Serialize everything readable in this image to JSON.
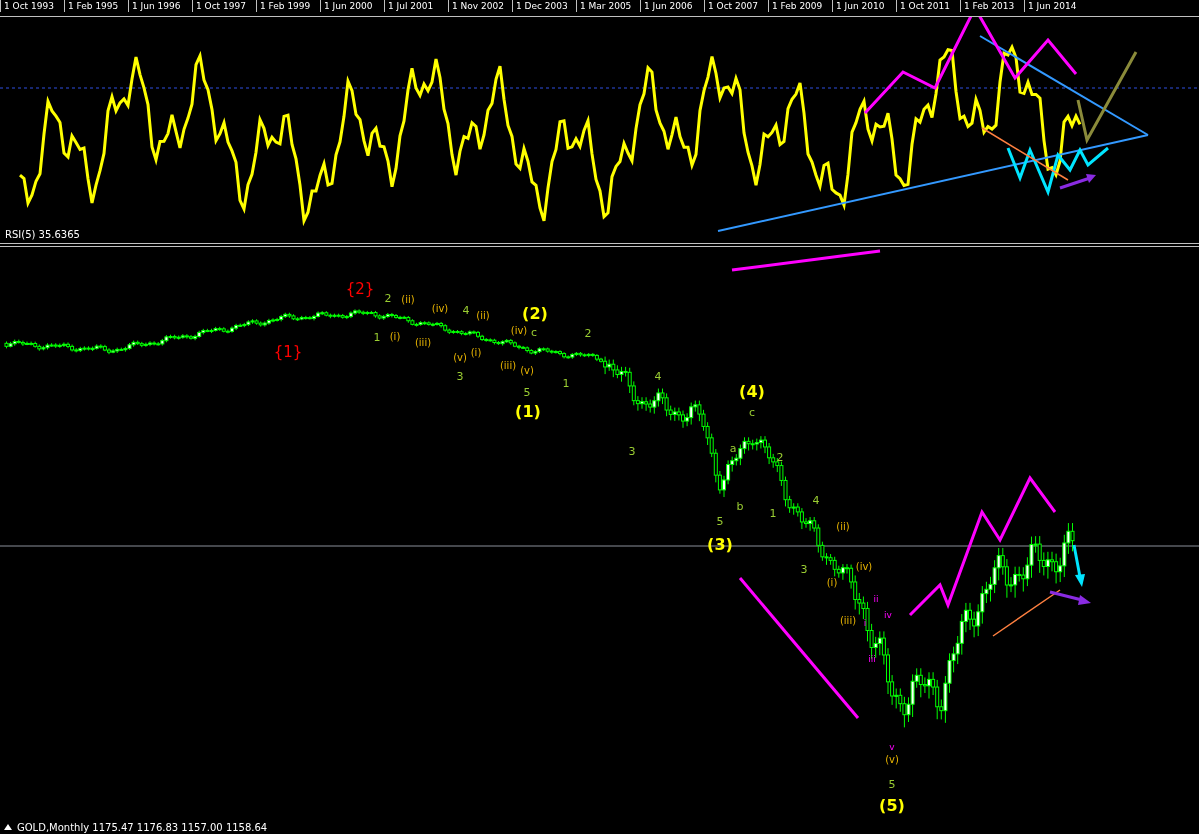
{
  "time_axis": {
    "labels": [
      "1 Oct 1993",
      "1 Feb 1995",
      "1 Jun 1996",
      "1 Oct 1997",
      "1 Feb 1999",
      "1 Jun 2000",
      "1 Jul 2001",
      "1 Nov 2002",
      "1 Dec 2003",
      "1 Mar 2005",
      "1 Jun 2006",
      "1 Oct 2007",
      "1 Feb 2009",
      "1 Jun 2010",
      "1 Oct 2011",
      "1 Feb 2013",
      "1 Jun 2014"
    ]
  },
  "rsi_panel": {
    "indicator_label": "RSI(5) 35.6365"
  },
  "price_panel": {
    "wave_labels": [
      {
        "text": "{2}",
        "kind": "cycle"
      },
      {
        "text": "2",
        "kind": "minor"
      },
      {
        "text": "(ii)",
        "kind": "intermediate"
      },
      {
        "text": "(iv)",
        "kind": "intermediate"
      },
      {
        "text": "4",
        "kind": "minor"
      },
      {
        "text": "(ii)",
        "kind": "intermediate"
      },
      {
        "text": "(2)",
        "kind": "primary"
      },
      {
        "text": "(iv)",
        "kind": "intermediate"
      },
      {
        "text": "c",
        "kind": "minor"
      },
      {
        "text": "2",
        "kind": "minor"
      },
      {
        "text": "1",
        "kind": "minor"
      },
      {
        "text": "(i)",
        "kind": "intermediate"
      },
      {
        "text": "(iii)",
        "kind": "intermediate"
      },
      {
        "text": "{1}",
        "kind": "cycle"
      },
      {
        "text": "(i)",
        "kind": "intermediate"
      },
      {
        "text": "(v)",
        "kind": "intermediate"
      },
      {
        "text": "(iii)",
        "kind": "intermediate"
      },
      {
        "text": "(v)",
        "kind": "intermediate"
      },
      {
        "text": "3",
        "kind": "minor"
      },
      {
        "text": "4",
        "kind": "minor"
      },
      {
        "text": "1",
        "kind": "minor"
      },
      {
        "text": "5",
        "kind": "minor"
      },
      {
        "text": "(4)",
        "kind": "primary"
      },
      {
        "text": "(1)",
        "kind": "primary"
      },
      {
        "text": "c",
        "kind": "minor"
      },
      {
        "text": "a",
        "kind": "minor"
      },
      {
        "text": "3",
        "kind": "minor"
      },
      {
        "text": "2",
        "kind": "minor"
      },
      {
        "text": "4",
        "kind": "minor"
      },
      {
        "text": "b",
        "kind": "minor"
      },
      {
        "text": "1",
        "kind": "minor"
      },
      {
        "text": "5",
        "kind": "minor"
      },
      {
        "text": "(ii)",
        "kind": "intermediate"
      },
      {
        "text": "(3)",
        "kind": "primary"
      },
      {
        "text": "(iv)",
        "kind": "intermediate"
      },
      {
        "text": "3",
        "kind": "minor"
      },
      {
        "text": "(i)",
        "kind": "intermediate"
      },
      {
        "text": "ii",
        "kind": "minute"
      },
      {
        "text": "iv",
        "kind": "minute"
      },
      {
        "text": "(iii)",
        "kind": "intermediate"
      },
      {
        "text": "i",
        "kind": "minute"
      },
      {
        "text": "iii",
        "kind": "minute"
      },
      {
        "text": "v",
        "kind": "minute"
      },
      {
        "text": "(v)",
        "kind": "intermediate"
      },
      {
        "text": "5",
        "kind": "minor"
      },
      {
        "text": "(5)",
        "kind": "primary"
      }
    ]
  },
  "status_bar": {
    "symbol_label": "GOLD,Monthly 1175.47 1176.83 1157.00 1158.64"
  }
}
